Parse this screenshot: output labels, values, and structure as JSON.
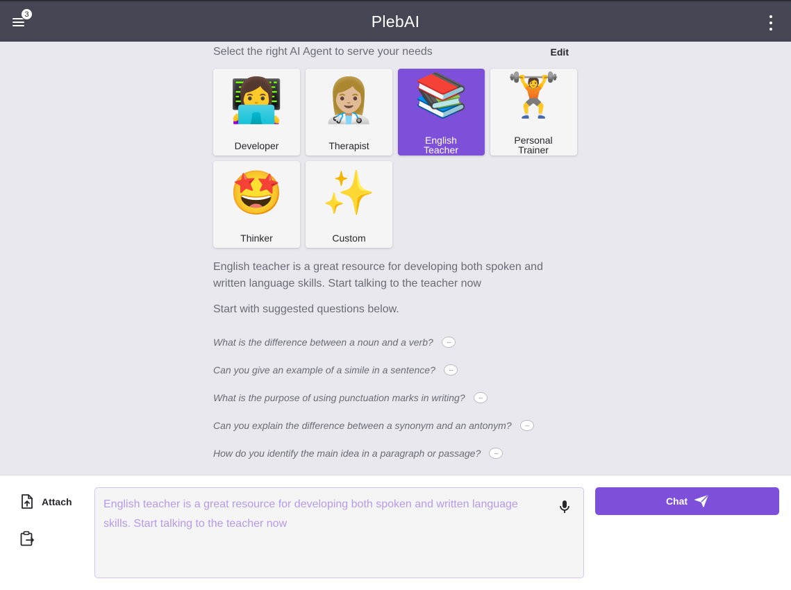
{
  "header": {
    "title": "PlebAI",
    "badge_count": "3",
    "menu_icon": "hamburger-menu-icon",
    "more_icon": "vertical-dots-icon"
  },
  "main": {
    "select_text": "Select the right AI Agent to serve your needs",
    "edit_label": "Edit",
    "agents": [
      {
        "label": "Developer",
        "emoji": "👩‍💻",
        "selected": false
      },
      {
        "label": "Therapist",
        "emoji": "👩🏼‍⚕️",
        "selected": false
      },
      {
        "label": "English Teacher",
        "emoji": "📚",
        "selected": true
      },
      {
        "label": "Personal Trainer",
        "emoji": "🏋️",
        "selected": false
      },
      {
        "label": "Thinker",
        "emoji": "🤩",
        "selected": false
      },
      {
        "label": "Custom",
        "emoji": "✨",
        "selected": false
      }
    ],
    "description": "English teacher is a great resource for developing both spoken and written language skills. Start talking to the teacher now",
    "suggest_heading": "Start with suggested questions below.",
    "questions": [
      "What is the difference between a noun and a verb?",
      "Can you give an example of a simile in a sentence?",
      "What is the purpose of using punctuation marks in writing?",
      "Can you explain the difference between a synonym and an antonym?",
      "How do you identify the main idea in a paragraph or passage?"
    ]
  },
  "composer": {
    "attach_label": "Attach",
    "placeholder": "English teacher is a great resource for developing both spoken and written language skills. Start talking to the teacher now",
    "chat_label": "Chat"
  },
  "colors": {
    "accent": "#7e4fd9",
    "header_bg": "#454653",
    "page_bg": "#e9e8ee"
  }
}
